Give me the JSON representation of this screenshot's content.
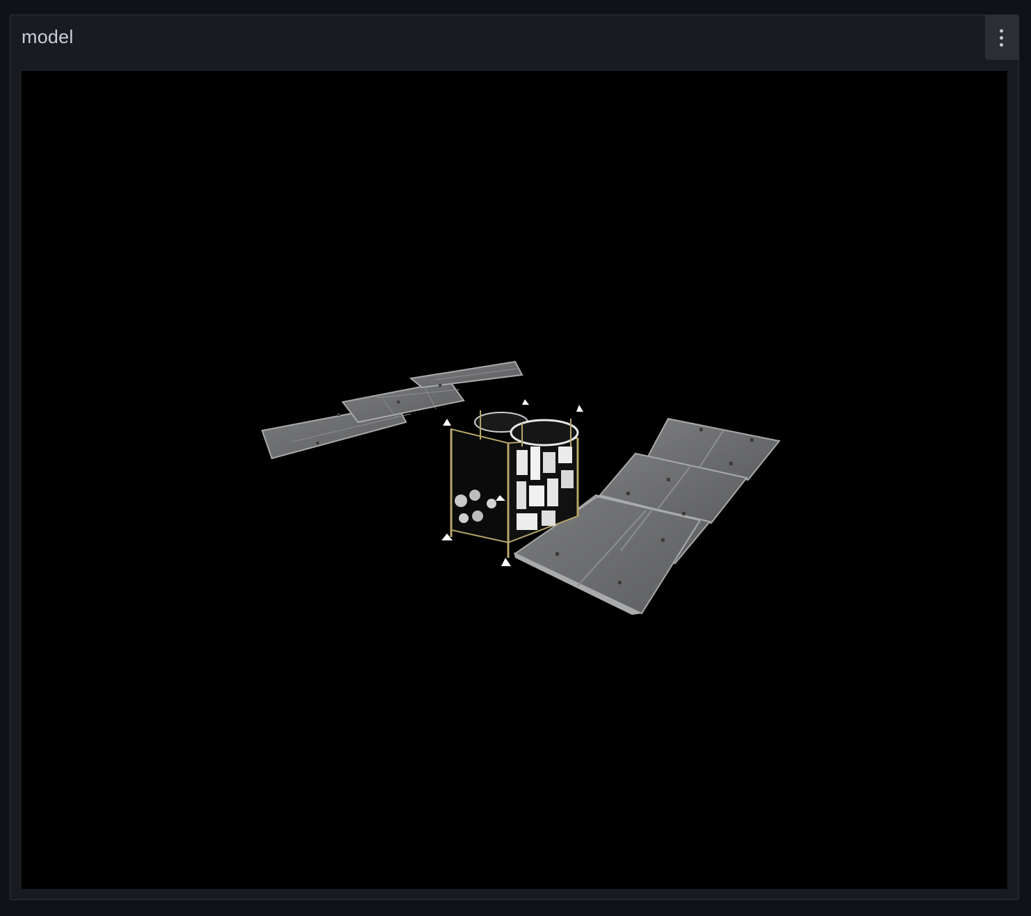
{
  "panel": {
    "title": "model",
    "menu_icon": "more-vertical-icon"
  },
  "viewer": {
    "background": "#000000",
    "subject": "spacecraft-3d-model",
    "colors": {
      "solar_panel": "#6f7072",
      "solar_panel_edge": "#a9aaab",
      "bus_dark": "#0b0b0b",
      "bus_foil": "#e9e9e9",
      "frame_gold": "#b8a66a"
    }
  }
}
